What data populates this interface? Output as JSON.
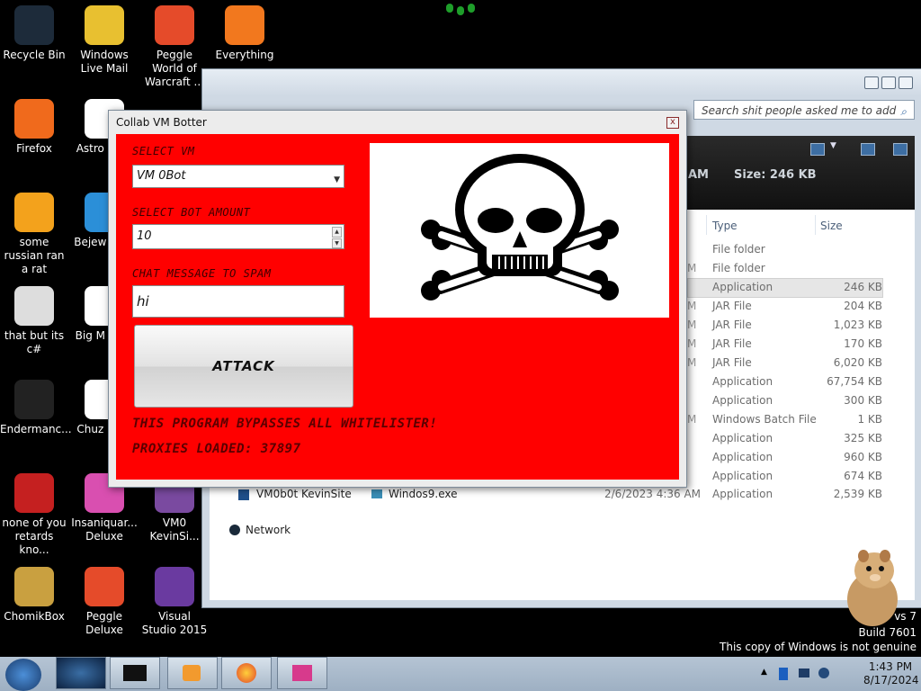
{
  "desktop": {
    "icons": [
      {
        "label": "Recycle Bin"
      },
      {
        "label": "Windows Live Mail"
      },
      {
        "label": "Peggle World of Warcraft ..."
      },
      {
        "label": "Everything"
      },
      {
        "label": "Firefox"
      },
      {
        "label": "Astro Delu"
      },
      {
        "label": "some russian ran a rat"
      },
      {
        "label": "Bejew Delu"
      },
      {
        "label": "that but its c#"
      },
      {
        "label": "Big M Delu"
      },
      {
        "label": "Endermanc..."
      },
      {
        "label": "Chuz Delu"
      },
      {
        "label": "none of you retards kno..."
      },
      {
        "label": "Insaniquar... Deluxe"
      },
      {
        "label": "VM0 KevinSi..."
      },
      {
        "label": "ChomikBox"
      },
      {
        "label": "Peggle Deluxe"
      },
      {
        "label": "Visual Studio 2015"
      }
    ]
  },
  "explorer": {
    "search_placeholder": "Search shit people asked me to add",
    "details_time": "AM",
    "details_size": "Size: 246 KB",
    "columns": {
      "type": "Type",
      "size": "Size"
    },
    "rows": [
      {
        "mark": "",
        "type": "File folder",
        "size": ""
      },
      {
        "mark": "M",
        "type": "File folder",
        "size": ""
      },
      {
        "mark": "",
        "type": "Application",
        "size": "246 KB"
      },
      {
        "mark": "M",
        "type": "JAR File",
        "size": "204 KB"
      },
      {
        "mark": "M",
        "type": "JAR File",
        "size": "1,023 KB"
      },
      {
        "mark": "M",
        "type": "JAR File",
        "size": "170 KB"
      },
      {
        "mark": "M",
        "type": "JAR File",
        "size": "6,020 KB"
      },
      {
        "mark": "",
        "type": "Application",
        "size": "67,754 KB"
      },
      {
        "mark": "",
        "type": "Application",
        "size": "300 KB"
      },
      {
        "mark": "M",
        "type": "Windows Batch File",
        "size": "1 KB"
      },
      {
        "mark": "",
        "type": "Application",
        "size": "325 KB"
      },
      {
        "mark": "",
        "type": "Application",
        "size": "960 KB"
      },
      {
        "mark": "",
        "type": "Application",
        "size": "674 KB"
      }
    ],
    "last_row": {
      "folder": "VM0b0t KevinSite",
      "name": "Windos9.exe",
      "date": "2/6/2023 4:36 AM",
      "type": "Application",
      "size": "2,539 KB"
    },
    "network_label": "Network"
  },
  "bot": {
    "title": "Collab VM Botter",
    "close_glyph": "x",
    "select_vm_label": "SELECT VM",
    "select_vm_value": "VM 0Bot",
    "bot_amount_label": "SELECT BOT AMOUNT",
    "bot_amount_value": "10",
    "chat_label": "CHAT MESSAGE TO SPAM",
    "chat_value": "hi",
    "attack_label": "ATTACK",
    "bypass_text": "THIS PROGRAM BYPASSES ALL WHITELISTER!",
    "proxies_text": "PROXIES LOADED: 37897",
    "colors": {
      "panel": "#ff0000",
      "skull": "#000000"
    }
  },
  "watermark": {
    "line1": "vs 7",
    "line2": "Build 7601",
    "line3": "This copy of Windows is not genuine"
  },
  "taskbar": {
    "time": "1:43 PM",
    "date": "8/17/2024"
  }
}
